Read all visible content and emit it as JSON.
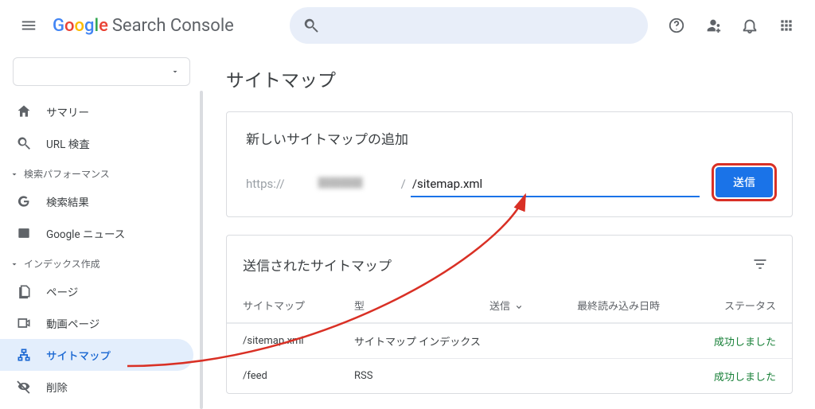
{
  "header": {
    "product": "Search Console"
  },
  "sidebar": {
    "summary": "サマリー",
    "url_inspect": "URL 検査",
    "section_perf": "検索パフォーマンス",
    "search_results": "検索結果",
    "google_news": "Google ニュース",
    "section_index": "インデックス作成",
    "pages": "ページ",
    "video_pages": "動画ページ",
    "sitemaps": "サイトマップ",
    "removals": "削除"
  },
  "main": {
    "title": "サイトマップ",
    "add": {
      "heading": "新しいサイトマップの追加",
      "prefix": "https://",
      "input_value": "/sitemap.xml",
      "submit": "送信"
    },
    "list": {
      "heading": "送信されたサイトマップ",
      "cols": {
        "sitemap": "サイトマップ",
        "type": "型",
        "sent": "送信",
        "date": "最終読み込み日時",
        "status": "ステータス"
      },
      "rows": [
        {
          "sitemap": "/sitemap.xml",
          "type": "サイトマップ インデックス",
          "status": "成功しました"
        },
        {
          "sitemap": "/feed",
          "type": "RSS",
          "status": "成功しました"
        }
      ]
    }
  }
}
